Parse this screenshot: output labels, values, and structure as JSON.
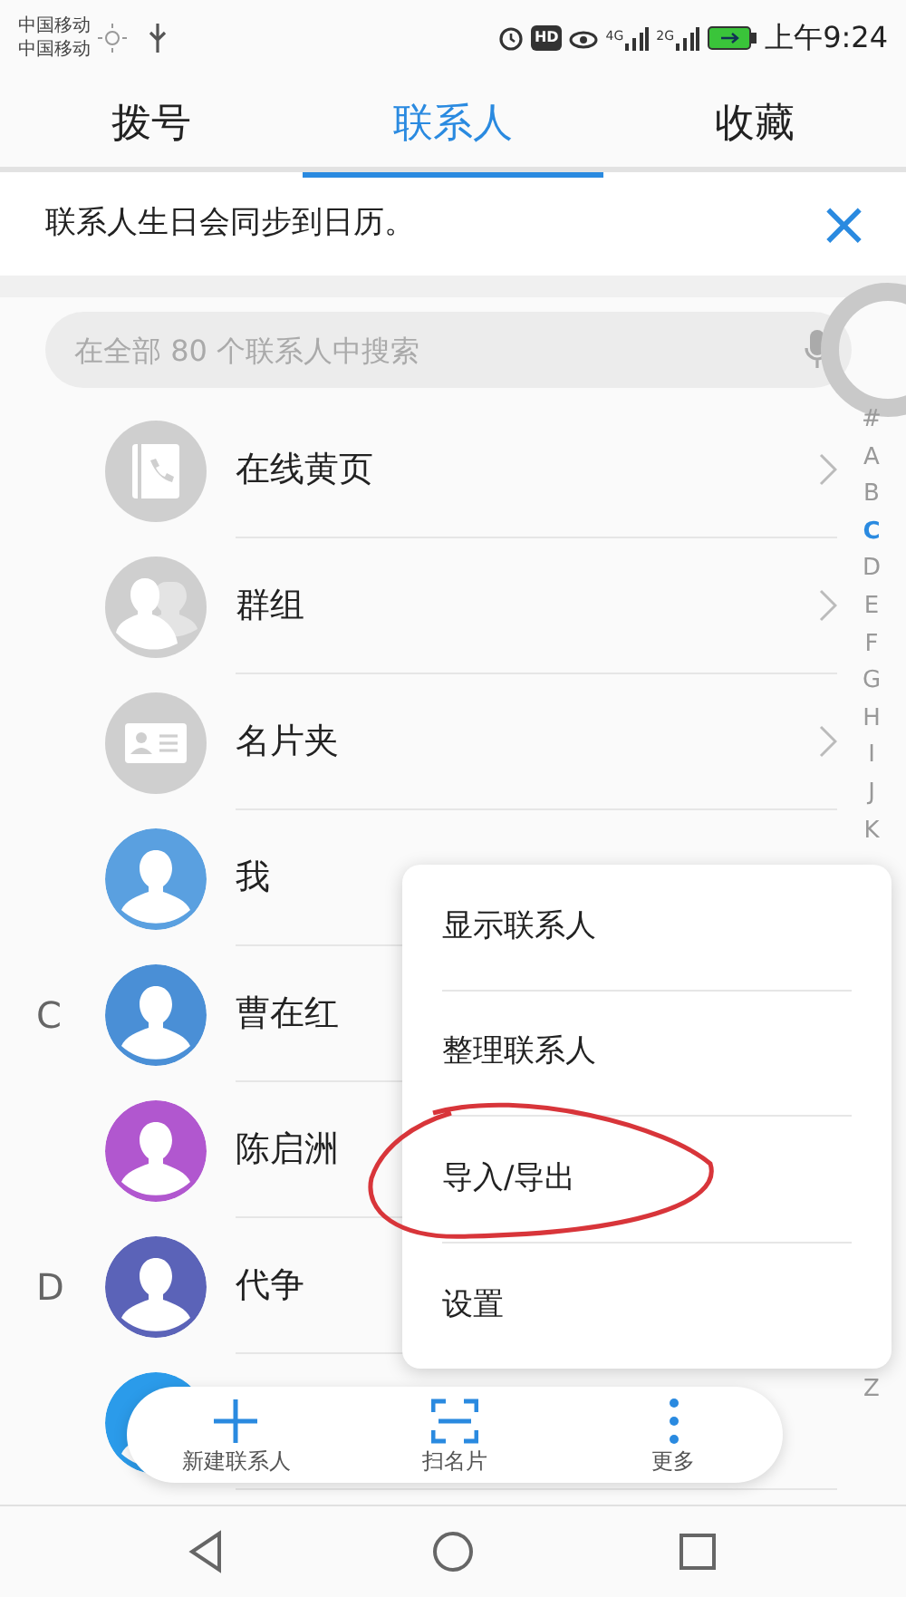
{
  "status_bar": {
    "carriers": [
      "中国移动",
      "中国移动"
    ],
    "hd_badge": "HD",
    "signals": [
      "4G",
      "2G"
    ],
    "time": "上午9:24"
  },
  "tabs": [
    {
      "label": "拨号",
      "selected": false
    },
    {
      "label": "联系人",
      "selected": true
    },
    {
      "label": "收藏",
      "selected": false
    }
  ],
  "banner": {
    "text": "联系人生日会同步到日历。",
    "close": "×"
  },
  "search": {
    "placeholder": "在全部 80 个联系人中搜索"
  },
  "contacts": [
    {
      "kind": "yellow_pages",
      "name": "在线黄页"
    },
    {
      "kind": "groups",
      "name": "群组"
    },
    {
      "kind": "card_holder",
      "name": "名片夹"
    },
    {
      "kind": "person",
      "name": "我",
      "color": "#5aa0e0"
    },
    {
      "kind": "person",
      "section": "C",
      "name": "曹在红",
      "color": "#4a8fd6"
    },
    {
      "kind": "person",
      "name": "陈启洲",
      "color": "#b157cf"
    },
    {
      "kind": "person",
      "section": "D",
      "name": "代争",
      "color": "#5b63b8"
    },
    {
      "kind": "person",
      "color": "#2b9bea"
    }
  ],
  "index_letters": [
    {
      "label": "#",
      "selected": false
    },
    {
      "label": "A",
      "selected": false
    },
    {
      "label": "B",
      "selected": false
    },
    {
      "label": "C",
      "selected": true
    },
    {
      "label": "D",
      "selected": false
    },
    {
      "label": "E",
      "selected": false
    },
    {
      "label": "F",
      "selected": false
    },
    {
      "label": "G",
      "selected": false
    },
    {
      "label": "H",
      "selected": false
    },
    {
      "label": "I",
      "selected": false
    },
    {
      "label": "J",
      "selected": false
    },
    {
      "label": "K",
      "selected": false
    },
    {
      "label": "Z",
      "selected": false
    }
  ],
  "menu": [
    {
      "label": "显示联系人",
      "circled": false
    },
    {
      "label": "整理联系人",
      "circled": false
    },
    {
      "label": "导入/导出",
      "circled": true
    },
    {
      "label": "设置",
      "circled": false
    }
  ],
  "toolbar": [
    {
      "kind": "add",
      "label": "新建联系人"
    },
    {
      "kind": "scan",
      "label": "扫名片"
    },
    {
      "kind": "more",
      "label": "更多"
    }
  ]
}
